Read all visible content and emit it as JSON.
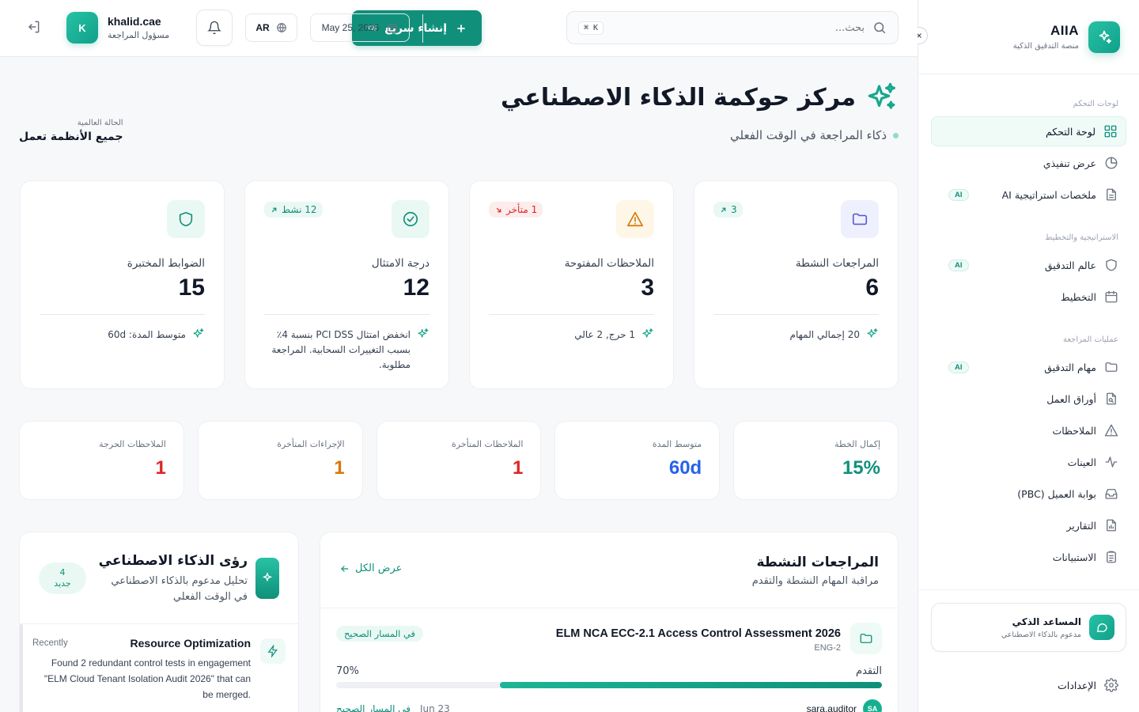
{
  "brand": {
    "name": "AIIA",
    "sub": "منصة التدقيق الذكية"
  },
  "sidebar": {
    "sections": [
      {
        "title": "لوحات التحكم",
        "items": [
          {
            "label": "لوحة التحكم",
            "icon": "dashboard-icon",
            "ai": false,
            "active": true
          },
          {
            "label": "عرض تنفيذي",
            "icon": "pie-chart-icon",
            "ai": false
          },
          {
            "label": "ملخصات استراتيجية AI",
            "icon": "document-icon",
            "ai": true
          }
        ]
      },
      {
        "title": "الاستراتيجية والتخطيط",
        "items": [
          {
            "label": "عالم التدقيق",
            "icon": "shield-icon",
            "ai": true
          },
          {
            "label": "التخطيط",
            "icon": "calendar-icon",
            "ai": false
          }
        ]
      },
      {
        "title": "عمليات المراجعة",
        "items": [
          {
            "label": "مهام التدقيق",
            "icon": "folder-icon",
            "ai": true
          },
          {
            "label": "أوراق العمل",
            "icon": "file-search-icon",
            "ai": false
          },
          {
            "label": "الملاحظات",
            "icon": "warning-icon",
            "ai": false
          },
          {
            "label": "العينات",
            "icon": "activity-icon",
            "ai": false
          },
          {
            "label": "بوابة العميل (PBC)",
            "icon": "inbox-icon",
            "ai": false
          },
          {
            "label": "التقارير",
            "icon": "report-icon",
            "ai": false
          },
          {
            "label": "الاستبيانات",
            "icon": "clipboard-icon",
            "ai": false
          }
        ]
      }
    ],
    "ai_badge": "AI",
    "assistant": {
      "title": "المساعد الذكي",
      "sub": "مدعوم بالذكاء الاصطناعي"
    },
    "settings": "الإعدادات"
  },
  "topbar": {
    "search_placeholder": "بحث...",
    "search_kbd": "⌘ K",
    "quick_create": "إنشاء سريع",
    "quick_kbd": "⌥N",
    "date": "May 25, 2026",
    "lang": "AR",
    "user": {
      "initial": "K",
      "name": "khalid.cae",
      "role": "مسؤول المراجعة"
    }
  },
  "page": {
    "title": "مركز حوكمة الذكاء الاصطناعي",
    "subtitle": "ذكاء المراجعة في الوقت الفعلي",
    "global_label": "الحالة العالمية",
    "global_value": "جميع الأنظمة تعمل"
  },
  "cards": [
    {
      "label": "المراجعات النشطة",
      "value": "6",
      "trend": "3",
      "trend_kind": "up",
      "foot": "20 إجمالي المهام",
      "icon": "folder-icon",
      "color": "#5b5bd6",
      "bg": "#eef0fd"
    },
    {
      "label": "الملاحظات المفتوحة",
      "value": "3",
      "trend": "1 متأخر",
      "trend_kind": "down",
      "foot": "1 حرج, 2 عالي",
      "icon": "warning-icon",
      "color": "#d97706",
      "bg": "#fef6e7"
    },
    {
      "label": "درجة الامتثال",
      "value": "12",
      "trend": "12 نشط",
      "trend_kind": "up",
      "foot": "انخفض امتثال PCI DSS بنسبة 4٪ بسبب التغييرات السحابية. المراجعة مطلوبة.",
      "icon": "check-circle-icon",
      "color": "#10907b",
      "bg": "#eaf8f3"
    },
    {
      "label": "الضوابط المختبرة",
      "value": "15",
      "trend": "",
      "trend_kind": "none",
      "foot": "متوسط المدة: 60d",
      "icon": "shield-icon",
      "color": "#10907b",
      "bg": "#eaf8f3"
    }
  ],
  "mini": [
    {
      "label": "إكمال الخطة",
      "value": "15%",
      "color": "#10907b"
    },
    {
      "label": "متوسط المدة",
      "value": "60d",
      "color": "#2563eb"
    },
    {
      "label": "الملاحظات المتأخرة",
      "value": "1",
      "color": "#dc2626"
    },
    {
      "label": "الإجراءات المتأخرة",
      "value": "1",
      "color": "#d97706"
    },
    {
      "label": "الملاحظات الحرجة",
      "value": "1",
      "color": "#dc2626"
    }
  ],
  "reviews": {
    "title": "المراجعات النشطة",
    "sub": "مراقبة المهام النشطة والتقدم",
    "view_all": "عرض الكل",
    "item": {
      "name": "ELM NCA ECC-2.1 Access Control Assessment 2026",
      "code": "ENG-2",
      "status": "في المسار الصحيح",
      "progress_label": "التقدم",
      "progress_text": "70%",
      "progress": 0.7,
      "owner_initials": "SA",
      "owner": "sara.auditor",
      "due": "Jun 23",
      "status2": "في المسار الصحيح"
    }
  },
  "insights": {
    "title": "رؤى الذكاء الاصطناعي",
    "sub": "تحليل مدعوم بالذكاء الاصطناعي في الوقت الفعلي",
    "new_count": "4",
    "new_label": "جديد",
    "item": {
      "title": "Resource Optimization",
      "time": "Recently",
      "text": "Found 2 redundant control tests in engagement \"ELM Cloud Tenant Isolation Audit 2026\" that can be merged."
    }
  }
}
